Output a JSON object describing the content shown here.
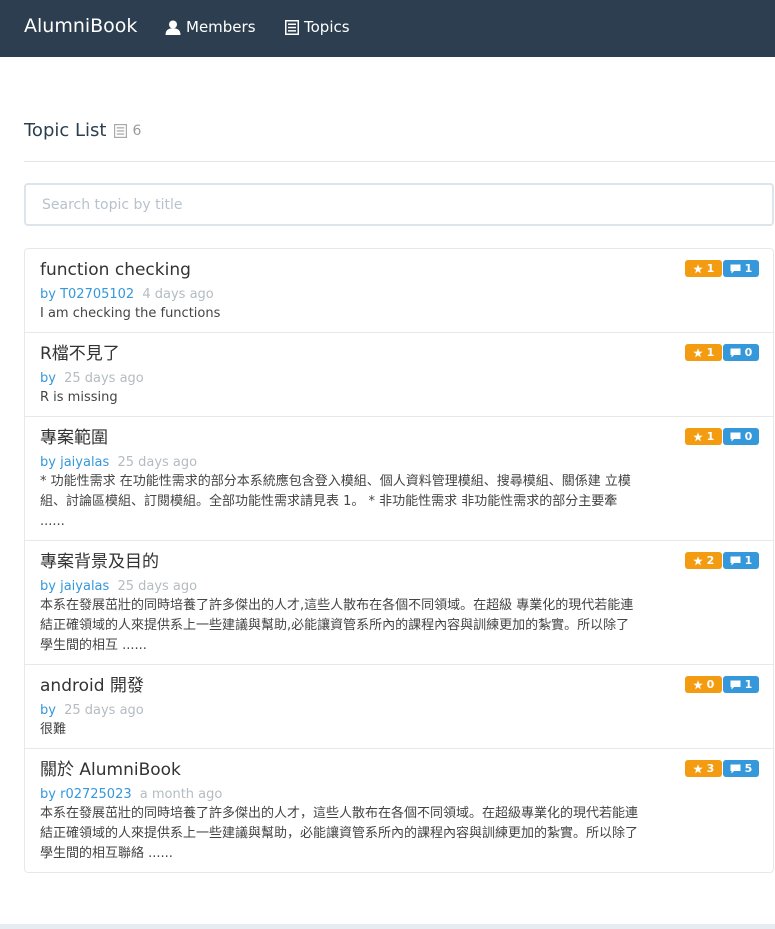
{
  "navbar": {
    "brand": "AlumniBook",
    "members_label": "Members",
    "topics_label": "Topics",
    "background_color": "#2c3e50"
  },
  "page": {
    "title": "Topic List",
    "topic_count": "6"
  },
  "search": {
    "placeholder": "Search topic by title",
    "value": ""
  },
  "colors": {
    "star_badge": "#f39c12",
    "comment_badge": "#3498db",
    "author_link": "#3498db"
  },
  "topics": [
    {
      "title": "function checking",
      "by": "by",
      "author": "T02705102",
      "time": "4 days ago",
      "description": "I am checking the functions",
      "stars": "1",
      "comments": "1"
    },
    {
      "title": "R檔不見了",
      "by": "by",
      "author": "",
      "time": "25 days ago",
      "description": "R is missing",
      "stars": "1",
      "comments": "0"
    },
    {
      "title": "專案範圍",
      "by": "by",
      "author": "jaiyalas",
      "time": "25 days ago",
      "description": "* 功能性需求 在功能性需求的部分本系統應包含登入模組、個人資料管理模組、搜尋模組、關係建 立模組、討論區模組、訂閱模組。全部功能性需求請見表 1。 * 非功能性需求 非功能性需求的部分主要牽 ......",
      "stars": "1",
      "comments": "0"
    },
    {
      "title": "專案背景及目的",
      "by": "by",
      "author": "jaiyalas",
      "time": "25 days ago",
      "description": "本系在發展茁壯的同時培養了許多傑出的人才,這些人散布在各個不同領域。在超級 專業化的現代若能連結正確領域的人來提供系上一些建議與幫助,必能讓資管系所內的課程內容與訓練更加的紮實。所以除了學生間的相互 ......",
      "stars": "2",
      "comments": "1"
    },
    {
      "title": "android 開發",
      "by": "by",
      "author": "",
      "time": "25 days ago",
      "description": "很難",
      "stars": "0",
      "comments": "1"
    },
    {
      "title": "關於 AlumniBook",
      "by": "by",
      "author": "r02725023",
      "time": "a month ago",
      "description": "本系在發展茁壯的同時培養了許多傑出的人才，這些人散布在各個不同領域。在超級專業化的現代若能連結正確領域的人來提供系上一些建議與幫助，必能讓資管系所內的課程內容與訓練更加的紮實。所以除了學生間的相互聯絡 ......",
      "stars": "3",
      "comments": "5"
    }
  ]
}
